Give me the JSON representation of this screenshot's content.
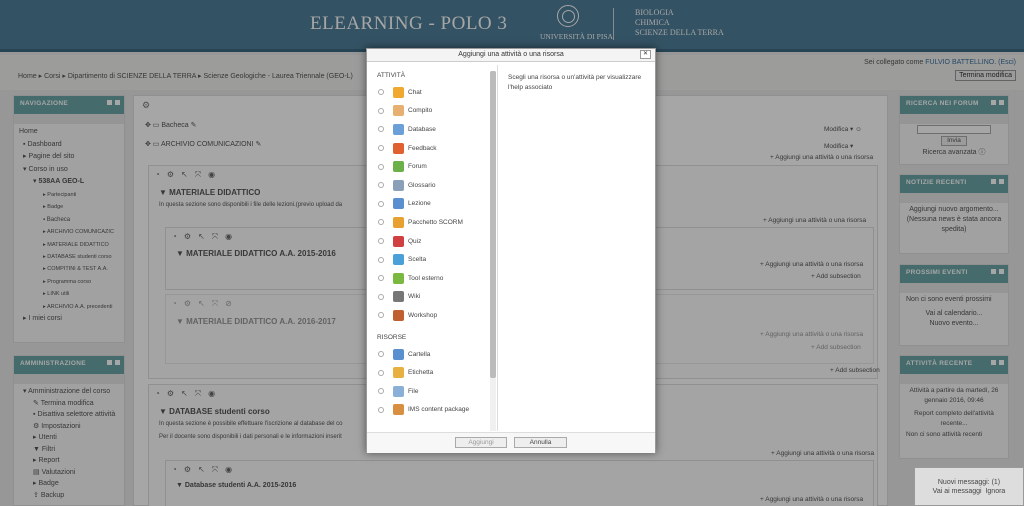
{
  "header": {
    "title": "ELEARNING - POLO 3",
    "university": "UNIVERSITÀ DI PISA",
    "departments": [
      "BIOLOGIA",
      "CHIMICA",
      "SCIENZE DELLA TERRA"
    ]
  },
  "topbar": {
    "breadcrumb": "Home ▸ Corsi ▸ Dipartimento di SCIENZE DELLA TERRA ▸ Scienze Geologiche - Laurea Triennale (GEO-L)",
    "login_prefix": "Sei collegato come ",
    "user": "FULVIO BATTELLINO",
    "logout": "(Esci)",
    "edit_button": "Termina modifica"
  },
  "navigation": {
    "title": "NAVIGAZIONE",
    "items": [
      {
        "label": "Home",
        "level": 0
      },
      {
        "label": "Dashboard",
        "level": 1
      },
      {
        "label": "Pagine del sito",
        "level": 1
      },
      {
        "label": "Corso in uso",
        "level": 1
      },
      {
        "label": "538AA GEO-L",
        "level": 2
      },
      {
        "label": "Partecipanti",
        "level": 3
      },
      {
        "label": "Badge",
        "level": 3
      },
      {
        "label": "Bacheca",
        "level": 3
      },
      {
        "label": "ARCHIVIO COMUNICAZIC",
        "level": 3
      },
      {
        "label": "MATERIALE DIDATTICO",
        "level": 3
      },
      {
        "label": "DATABASE studenti corso",
        "level": 3
      },
      {
        "label": "COMPITINI & TEST A.A.",
        "level": 3
      },
      {
        "label": "Programma corso",
        "level": 3
      },
      {
        "label": "LINK utili",
        "level": 3
      },
      {
        "label": "ARCHIVIO A.A. precedenti",
        "level": 3
      },
      {
        "label": "I miei corsi",
        "level": 1
      }
    ]
  },
  "admin": {
    "title": "AMMINISTRAZIONE",
    "items": [
      "Amministrazione del corso",
      "Termina modifica",
      "Disattiva selettore attività",
      "Impostazioni",
      "Utenti",
      "Filtri",
      "Report",
      "Valutazioni",
      "Badge",
      "Backup"
    ]
  },
  "course": {
    "bacheca": "Bacheca",
    "archivio": "ARCHIVIO COMUNICAZIONI",
    "modifica": "Modifica",
    "add_activity": "Aggiungi una attività o una risorsa",
    "add_subsection": "Add subsection",
    "section1_title": "MATERIALE DIDATTICO",
    "section1_text": "In questa sezione sono disponibili i file delle lezioni.(previo upload da",
    "sub1_title": "MATERIALE DIDATTICO A.A. 2015-2016",
    "sub2_title": "MATERIALE DIDATTICO A.A. 2016-2017",
    "section2_title": "DATABASE studenti corso",
    "section2_text1": "In questa sezione è possibile effettuare l'iscrizione al database del co",
    "section2_text2": "Per il docente sono disponibili i dati personali e le informazioni inserit",
    "sub3_title": "Database studenti A.A. 2015-2016"
  },
  "right": {
    "forum_title": "RICERCA NEI FORUM",
    "forum_button": "Invia",
    "forum_advanced": "Ricerca avanzata",
    "news_title": "NOTIZIE RECENTI",
    "news_add": "Aggiungi nuovo argomento...",
    "news_none": "(Nessuna news è stata ancora spedita)",
    "events_title": "PROSSIMI EVENTI",
    "events_none": "Non ci sono eventi prossimi",
    "events_calendar": "Vai al calendario...",
    "events_new": "Nuovo evento...",
    "activity_title": "ATTIVITÀ RECENTE",
    "activity_since": "Attività a partire da martedì, 26 gennaio 2016, 09:46",
    "activity_report": "Report completo dell'attività recente...",
    "activity_none": "Non ci sono attività recenti"
  },
  "messages": {
    "new": "Nuovi messaggi: (1)",
    "go": "Vai ai messaggi",
    "ignore": "Ignora"
  },
  "modal": {
    "title": "Aggiungi una attività o una risorsa",
    "activities_header": "ATTIVITÀ",
    "resources_header": "RISORSE",
    "help_text": "Scegli una risorsa o un'attività per visualizzare l'help associato",
    "add_button": "Aggiungi",
    "cancel_button": "Annulla",
    "activities": [
      {
        "label": "Chat",
        "icon": "chat-icon",
        "color": "#f0a830"
      },
      {
        "label": "Compito",
        "icon": "assignment-icon",
        "color": "#e8b070"
      },
      {
        "label": "Database",
        "icon": "database-icon",
        "color": "#6a9fd8"
      },
      {
        "label": "Feedback",
        "icon": "feedback-icon",
        "color": "#e06030"
      },
      {
        "label": "Forum",
        "icon": "forum-icon",
        "color": "#6cb04a"
      },
      {
        "label": "Glossario",
        "icon": "glossary-icon",
        "color": "#8aa0b8"
      },
      {
        "label": "Lezione",
        "icon": "lesson-icon",
        "color": "#5a90d0"
      },
      {
        "label": "Pacchetto SCORM",
        "icon": "scorm-icon",
        "color": "#e8a030"
      },
      {
        "label": "Quiz",
        "icon": "quiz-icon",
        "color": "#d04040"
      },
      {
        "label": "Scelta",
        "icon": "choice-icon",
        "color": "#4aa0d8"
      },
      {
        "label": "Tool esterno",
        "icon": "puzzle-icon",
        "color": "#7ab840"
      },
      {
        "label": "Wiki",
        "icon": "wiki-icon",
        "color": "#777777"
      },
      {
        "label": "Workshop",
        "icon": "workshop-icon",
        "color": "#c06030"
      }
    ],
    "resources": [
      {
        "label": "Cartella",
        "icon": "folder-icon",
        "color": "#5a90d0"
      },
      {
        "label": "Etichetta",
        "icon": "label-icon",
        "color": "#e8b040"
      },
      {
        "label": "File",
        "icon": "file-icon",
        "color": "#8ab0d8"
      },
      {
        "label": "IMS content package",
        "icon": "package-icon",
        "color": "#d89040"
      }
    ]
  }
}
